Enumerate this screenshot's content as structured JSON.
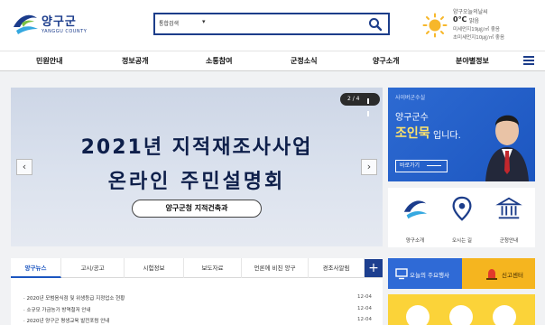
{
  "header": {
    "logo_name": "양구군",
    "logo_sub": "YANGGU COUNTY",
    "search": {
      "select_label": "통합검색",
      "placeholder": ""
    },
    "weather": {
      "title": "양구오늘의날씨",
      "temp": "0℃",
      "condition": "맑음",
      "pm10": "미세먼지19㎍/㎥ 좋음",
      "pm25": "초미세먼지10㎍/㎥ 좋음"
    }
  },
  "nav": {
    "items": [
      "민원안내",
      "정보공개",
      "소통참여",
      "군정소식",
      "양구소개",
      "분야별정보"
    ]
  },
  "banner": {
    "line1": "2021년 지적재조사사업",
    "line2": "온라인 주민설명회",
    "tag": "양구군청 지적건축과",
    "pager": "2 / 4"
  },
  "mayor": {
    "label": "사이버군수실",
    "line1": "양구군수",
    "name": "조인묵",
    "line3": "입니다.",
    "button": "바로가기"
  },
  "quick": {
    "items": [
      "양구소개",
      "오시는 길",
      "군청안내"
    ]
  },
  "news": {
    "tabs": [
      "양구뉴스",
      "고시/공고",
      "시험정보",
      "보도자료",
      "언론에 비친 양구",
      "경조사알림"
    ],
    "rows": [
      {
        "title": "2020년 모범음식점 및 위생등급 지정업소 현황",
        "date": "12-04"
      },
      {
        "title": "소규모 가금농가 방역철저 안내",
        "date": "12-04"
      },
      {
        "title": "2020년 양구군 평생교육 발전포럼 안내",
        "date": "12-04"
      }
    ]
  },
  "side_links": {
    "today_label": "오늘의 주요행사",
    "report_label": "신고센터"
  },
  "colors": {
    "brand": "#1c3d8a",
    "accent_blue": "#2f6ad6",
    "accent_yellow": "#f5b51f"
  }
}
